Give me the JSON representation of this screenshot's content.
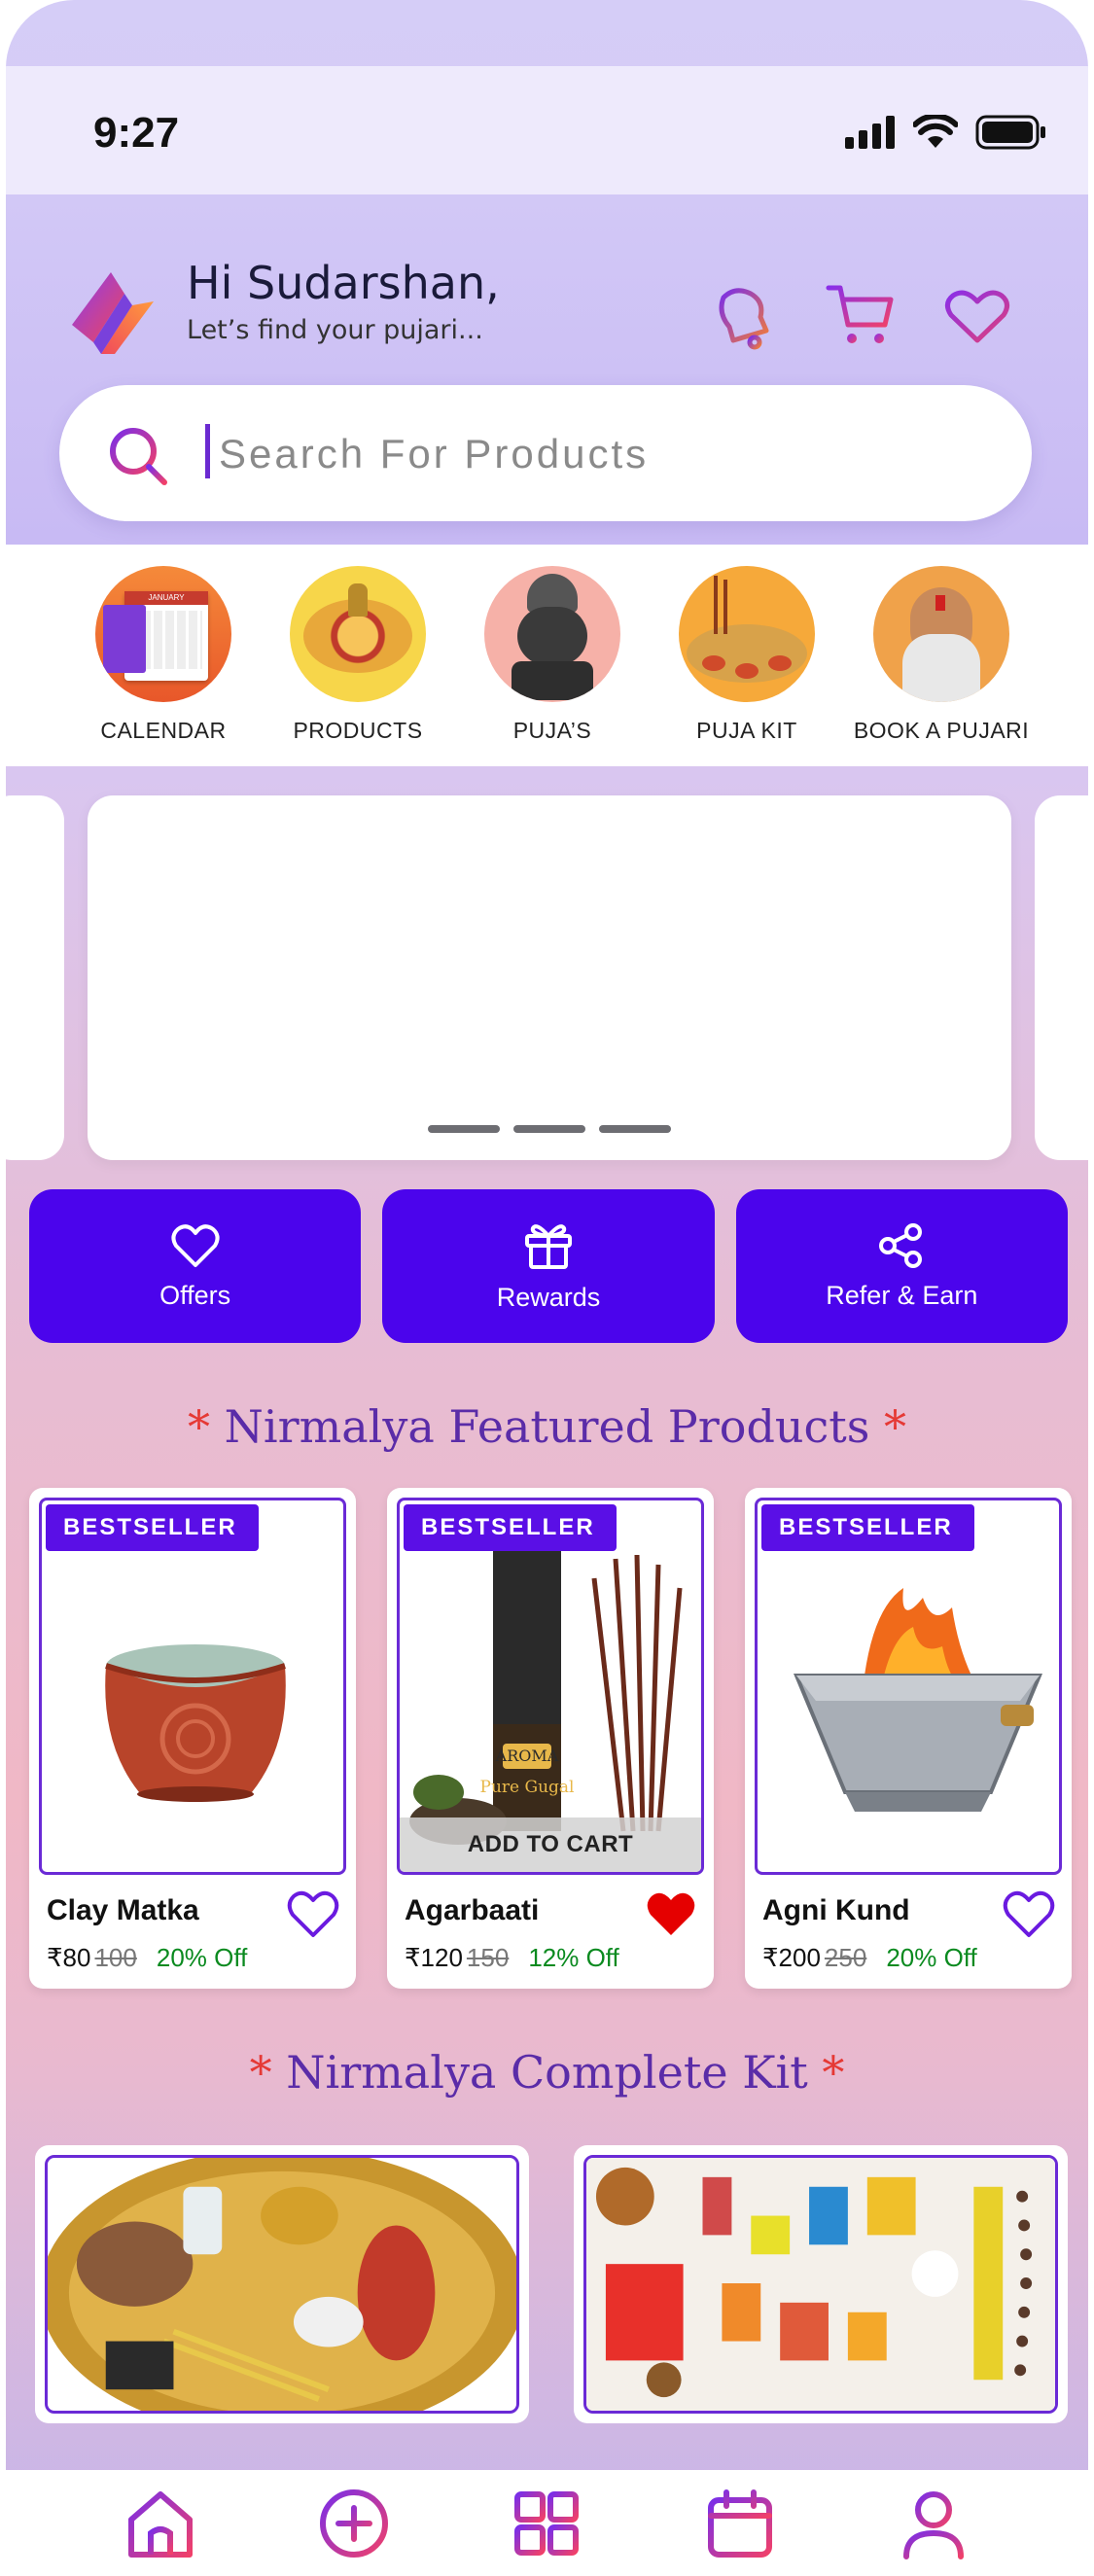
{
  "status_bar": {
    "time": "9:27"
  },
  "header": {
    "greeting": "Hi Sudarshan,",
    "subtitle": "Let’s find your pujari..."
  },
  "search": {
    "placeholder": "Search For Products"
  },
  "categories": [
    {
      "label": "CALENDAR"
    },
    {
      "label": "PRODUCTS"
    },
    {
      "label": "PUJA’S"
    },
    {
      "label": "PUJA KIT"
    },
    {
      "label": "BOOK A PUJARI"
    }
  ],
  "actions": [
    {
      "label": "Offers",
      "icon": "heart-icon"
    },
    {
      "label": "Rewards",
      "icon": "gift-icon"
    },
    {
      "label": "Refer & Earn",
      "icon": "share-icon"
    }
  ],
  "featured": {
    "title": "Nirmalya Featured Products",
    "star": "*",
    "products": [
      {
        "badge": "BESTSELLER",
        "name": "Clay Matka",
        "price": "₹80",
        "mrp": "100",
        "discount": "20% Off",
        "favorite": false
      },
      {
        "badge": "BESTSELLER",
        "name": "Agarbaati",
        "price": "₹120",
        "mrp": "150",
        "discount": "12% Off",
        "favorite": true,
        "cta": "ADD TO CART"
      },
      {
        "badge": "BESTSELLER",
        "name": "Agni Kund",
        "price": "₹200",
        "mrp": "250",
        "discount": "20% Off",
        "favorite": false
      }
    ]
  },
  "kits": {
    "title": "Nirmalya Complete Kit",
    "star": "*"
  },
  "calendar_thumb": {
    "month": "JANUARY"
  },
  "agarbaati_pack": {
    "brand": "AROMA",
    "product": "Pure Gugal"
  },
  "colors": {
    "primary": "#4b04ec",
    "accent": "#6a2ad6",
    "sale": "#0a8a1f",
    "heart": "#e50000"
  },
  "bottom_nav": [
    "home-icon",
    "add-circle-icon",
    "grid-icon",
    "calendar-icon",
    "profile-icon"
  ]
}
